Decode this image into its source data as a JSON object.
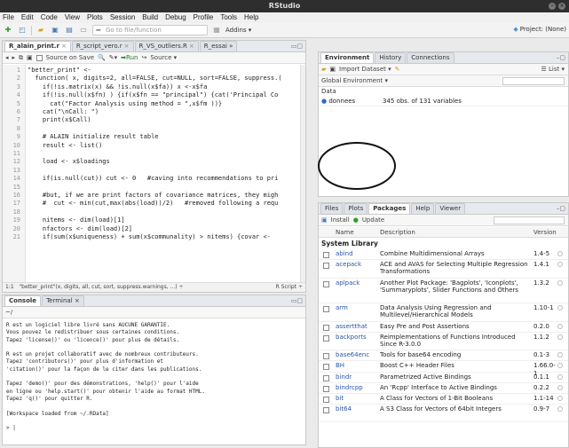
{
  "window": {
    "title": "RStudio"
  },
  "menu": [
    "File",
    "Edit",
    "Code",
    "View",
    "Plots",
    "Session",
    "Build",
    "Debug",
    "Profile",
    "Tools",
    "Help"
  ],
  "toolbar": {
    "goto_placeholder": "Go to file/function",
    "addins_label": "Addins ▾",
    "project_label": "Project: (None)"
  },
  "editor": {
    "tabs": [
      {
        "label": "R_alain_print.r",
        "active": true
      },
      {
        "label": "R_script_vero.r",
        "active": false
      },
      {
        "label": "R_VS_outliers.R",
        "active": false
      },
      {
        "label": "R_essai",
        "active": false
      }
    ],
    "source_on_save": "Source on Save",
    "run_label": "➡Run",
    "source_label": "Source ▾",
    "lines": [
      {
        "n": "1",
        "t": "\"better_print\" <-"
      },
      {
        "n": "2",
        "t": "  function( x, digits=2, all=FALSE, cut=NULL, sort=FALSE, suppress.("
      },
      {
        "n": "3",
        "t": "    if(!is.matrix(x) && !is.null(x$fa)) x <-x$fa"
      },
      {
        "n": "4",
        "t": "    if(!is.null(x$fn) ) {if(x$fn == \"principal\") {cat('Principal Co"
      },
      {
        "n": "5",
        "t": "      cat(\"Factor Analysis using method = \",x$fm ))}"
      },
      {
        "n": "6",
        "t": "    cat(\"\\nCall: \")"
      },
      {
        "n": "7",
        "t": "    print(x$Call)"
      },
      {
        "n": "8",
        "t": ""
      },
      {
        "n": "9",
        "t": "    # ALAIN initialize result table"
      },
      {
        "n": "10",
        "t": "    result <- list()"
      },
      {
        "n": "11",
        "t": ""
      },
      {
        "n": "12",
        "t": "    load <- x$loadings"
      },
      {
        "n": "13",
        "t": ""
      },
      {
        "n": "14",
        "t": "    if(is.null(cut)) cut <- 0   #caving into recommendations to pri"
      },
      {
        "n": "15",
        "t": ""
      },
      {
        "n": "16",
        "t": "    #but, if we are print factors of covariance matrices, they migh"
      },
      {
        "n": "17",
        "t": "    #  cut <- min(cut,max(abs(load))/2)   #removed following a requ"
      },
      {
        "n": "18",
        "t": ""
      },
      {
        "n": "19",
        "t": "    nitems <- dim(load)[1]"
      },
      {
        "n": "20",
        "t": "    nfactors <- dim(load)[2]"
      },
      {
        "n": "21",
        "t": "    if(sum(x$uniqueness) + sum(x$communality) > nitems) {covar <- "
      }
    ],
    "status_pos": "1:1",
    "status_fn": "\"better_print\"(x, digits, all, cut, sort, suppress.warnings, ...) ÷",
    "status_type": "R Script ÷"
  },
  "console": {
    "tabs": [
      "Console",
      "Terminal ×"
    ],
    "path": "~/",
    "text": "R est un logiciel libre livré sans AUCUNE GARANTIE.\nVous pouvez le redistribuer sous certaines conditions.\nTapez 'license()' ou 'licence()' pour plus de détails.\n\nR est un projet collaboratif avec de nombreux contributeurs.\nTapez 'contributors()' pour plus d'information et\n'citation()' pour la façon de le citer dans les publications.\n\nTapez 'demo()' pour des démonstrations, 'help()' pour l'aide\nen ligne ou 'help.start()' pour obtenir l'aide au format HTML.\nTapez 'q()' pour quitter R.\n\n[Workspace loaded from ~/.RData]\n\n> |"
  },
  "environment": {
    "tabs": [
      "Environment",
      "History",
      "Connections"
    ],
    "import_label": "Import Dataset ▾",
    "list_label": "☰ List ▾",
    "scope": "Global Environment ▾",
    "section": "Data",
    "rows": [
      {
        "name": "donnees",
        "value": "345 obs. of 131 variables"
      }
    ]
  },
  "packages": {
    "tabs": [
      "Files",
      "Plots",
      "Packages",
      "Help",
      "Viewer"
    ],
    "install_label": "Install",
    "update_label": "Update",
    "columns": [
      "Name",
      "Description",
      "Version"
    ],
    "section": "System Library",
    "rows": [
      {
        "name": "abind",
        "desc": "Combine Multidimensional Arrays",
        "ver": "1.4-5"
      },
      {
        "name": "acepack",
        "desc": "ACE and AVAS for Selecting Multiple Regression Transformations",
        "ver": "1.4.1"
      },
      {
        "name": "aplpack",
        "desc": "Another Plot Package: 'Bagplots', 'Iconplots', 'Summaryplots', Slider Functions and Others",
        "ver": "1.3.2"
      },
      {
        "name": "arm",
        "desc": "Data Analysis Using Regression and Multilevel/Hierarchical Models",
        "ver": "1.10-1"
      },
      {
        "name": "assertthat",
        "desc": "Easy Pre and Post Assertions",
        "ver": "0.2.0"
      },
      {
        "name": "backports",
        "desc": "Reimplementations of Functions Introduced Since R-3.0.0",
        "ver": "1.1.2"
      },
      {
        "name": "base64enc",
        "desc": "Tools for base64 encoding",
        "ver": "0.1-3"
      },
      {
        "name": "BH",
        "desc": "Boost C++ Header Files",
        "ver": "1.66.0-1"
      },
      {
        "name": "bindr",
        "desc": "Parametrized Active Bindings",
        "ver": "0.1.1"
      },
      {
        "name": "bindrcpp",
        "desc": "An 'Rcpp' Interface to Active Bindings",
        "ver": "0.2.2"
      },
      {
        "name": "bit",
        "desc": "A Class for Vectors of 1-Bit Booleans",
        "ver": "1.1-14"
      },
      {
        "name": "bit64",
        "desc": "A S3 Class for Vectors of 64bit Integers",
        "ver": "0.9-7"
      }
    ]
  }
}
